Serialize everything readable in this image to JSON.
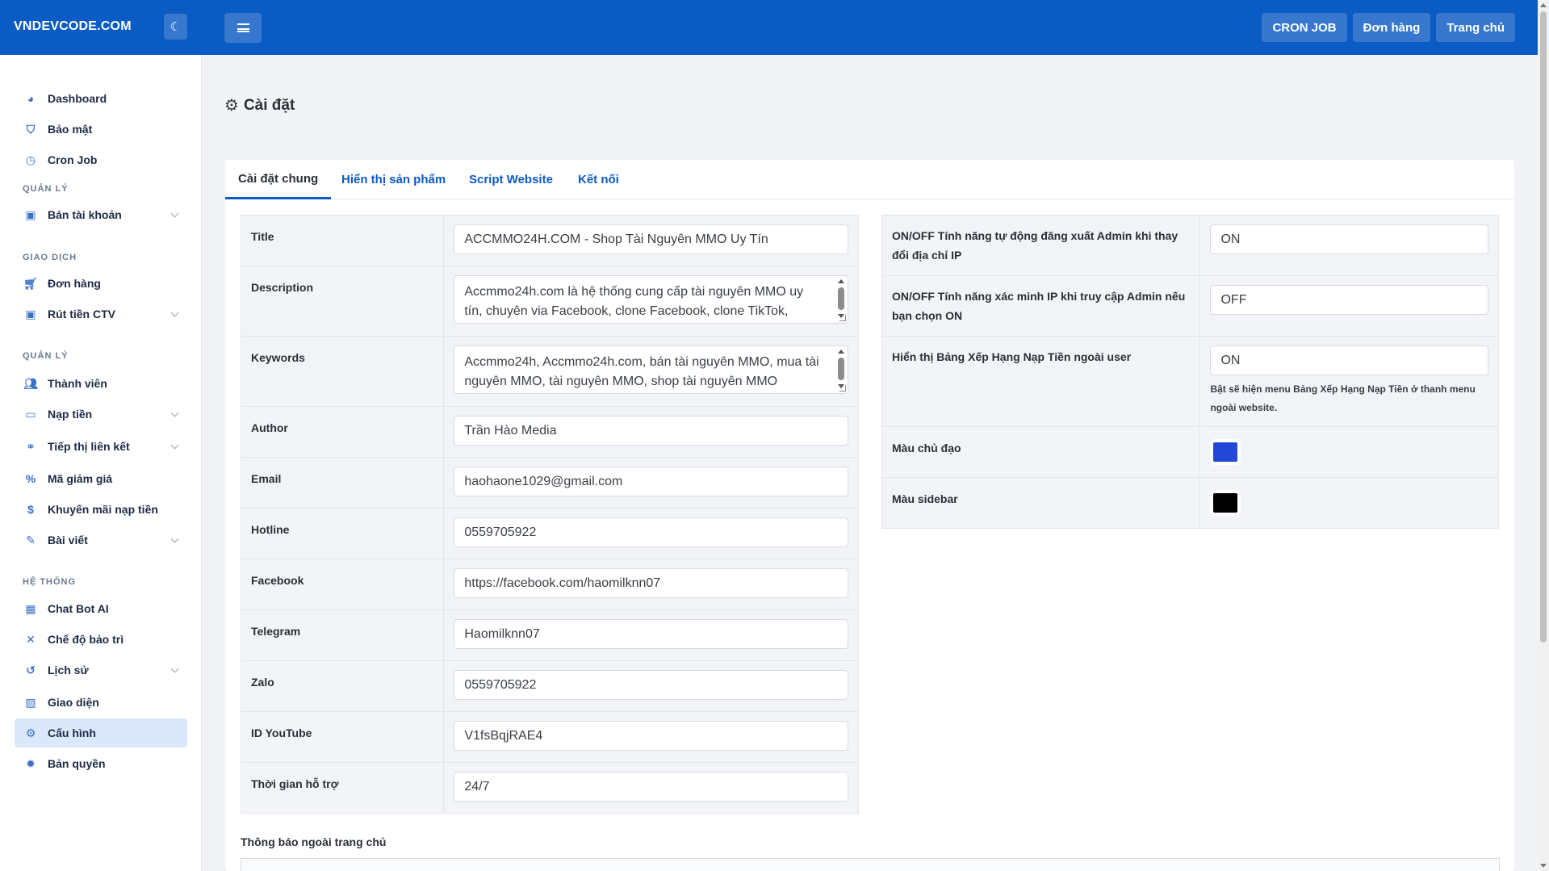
{
  "brand": "VNDEVCODE.COM",
  "topbar": {
    "actions": [
      "CRON JOB",
      "Đơn hàng",
      "Trang chủ"
    ]
  },
  "sidebar": {
    "items_top": [
      {
        "label": "Dashboard",
        "icon": "palette-icon"
      },
      {
        "label": "Bảo mật",
        "icon": "shield-icon"
      },
      {
        "label": "Cron Job",
        "icon": "clock-icon"
      }
    ],
    "section1": "QUẢN LÝ",
    "section1_items": [
      {
        "label": "Bán tài khoản",
        "icon": "box-icon"
      }
    ],
    "section2": "GIAO DỊCH",
    "section2_items": [
      {
        "label": "Đơn hàng",
        "icon": "cart-icon"
      },
      {
        "label": "Rút tiền CTV",
        "icon": "box-icon"
      }
    ],
    "section3": "QUẢN LÝ",
    "section3_items": [
      {
        "label": "Thành viên",
        "icon": "users-icon"
      },
      {
        "label": "Nạp tiền",
        "icon": "wallet-icon"
      },
      {
        "label": "Tiếp thị liên kết",
        "icon": "handshake-icon"
      },
      {
        "label": "Mã giảm giá",
        "icon": "percent-icon"
      },
      {
        "label": "Khuyến mãi nạp tiền",
        "icon": "dollar-icon"
      },
      {
        "label": "Bài viết",
        "icon": "blog-icon"
      }
    ],
    "section4": "HỆ THỐNG",
    "section4_items": [
      {
        "label": "Chat Bot AI",
        "icon": "robot-icon"
      },
      {
        "label": "Chế độ bảo trì",
        "icon": "tools-icon"
      },
      {
        "label": "Lịch sử",
        "icon": "history-icon"
      },
      {
        "label": "Giao diện",
        "icon": "image-icon"
      },
      {
        "label": "Cấu hình",
        "icon": "gear-icon"
      },
      {
        "label": "Bản quyền",
        "icon": "badge-icon"
      }
    ]
  },
  "page": {
    "title": "Cài đặt"
  },
  "tabs": [
    "Cài đặt chung",
    "Hiển thị sản phẩm",
    "Script Website",
    "Kết nối"
  ],
  "left_form": [
    {
      "label": "Title",
      "value": "ACCMMO24H.COM - Shop Tài Nguyên MMO Uy Tín",
      "type": "input"
    },
    {
      "label": "Description",
      "value": "Accmmo24h.com là hệ thống cung cấp tài nguyên MMO uy tín, chuyên via Facebook, clone Facebook, clone TikTok,",
      "type": "textarea"
    },
    {
      "label": "Keywords",
      "value": "Accmmo24h, Accmmo24h.com, bán tài nguyên MMO, mua tài nguyên MMO, tài nguyên MMO, shop tài nguyên MMO",
      "type": "textarea"
    },
    {
      "label": "Author",
      "value": "Trần Hào Media",
      "type": "input"
    },
    {
      "label": "Email",
      "value": "haohaone1029@gmail.com",
      "type": "input"
    },
    {
      "label": "Hotline",
      "value": "0559705922",
      "type": "input"
    },
    {
      "label": "Facebook",
      "value": "https://facebook.com/haomilknn07",
      "type": "input"
    },
    {
      "label": "Telegram",
      "value": "Haomilknn07",
      "type": "input"
    },
    {
      "label": "Zalo",
      "value": "0559705922",
      "type": "input"
    },
    {
      "label": "ID YouTube",
      "value": "V1fsBqjRAE4",
      "type": "input"
    },
    {
      "label": "Thời gian hỗ trợ",
      "value": "24/7",
      "type": "input"
    }
  ],
  "right_form": [
    {
      "label": "ON/OFF Tính năng tự động đăng xuất Admin khi thay đổi địa chỉ IP",
      "value": "ON"
    },
    {
      "label": "ON/OFF Tính năng xác minh IP khi truy cập Admin nếu bạn chọn ON",
      "value": "OFF"
    },
    {
      "label": "Hiển thị Bảng Xếp Hạng Nạp Tiền ngoài user",
      "value": "ON",
      "hint": "Bật sẽ hiện menu Bảng Xếp Hạng Nạp Tiền ở thanh menu ngoài website."
    }
  ],
  "colors": {
    "label_primary": "Màu chủ đạo",
    "primary": "#2347d6",
    "label_sidebar": "Màu sidebar",
    "sidebar": "#000000",
    "accent": "#0b5bc4"
  },
  "notice_label": "Thông báo ngoài trang chủ"
}
